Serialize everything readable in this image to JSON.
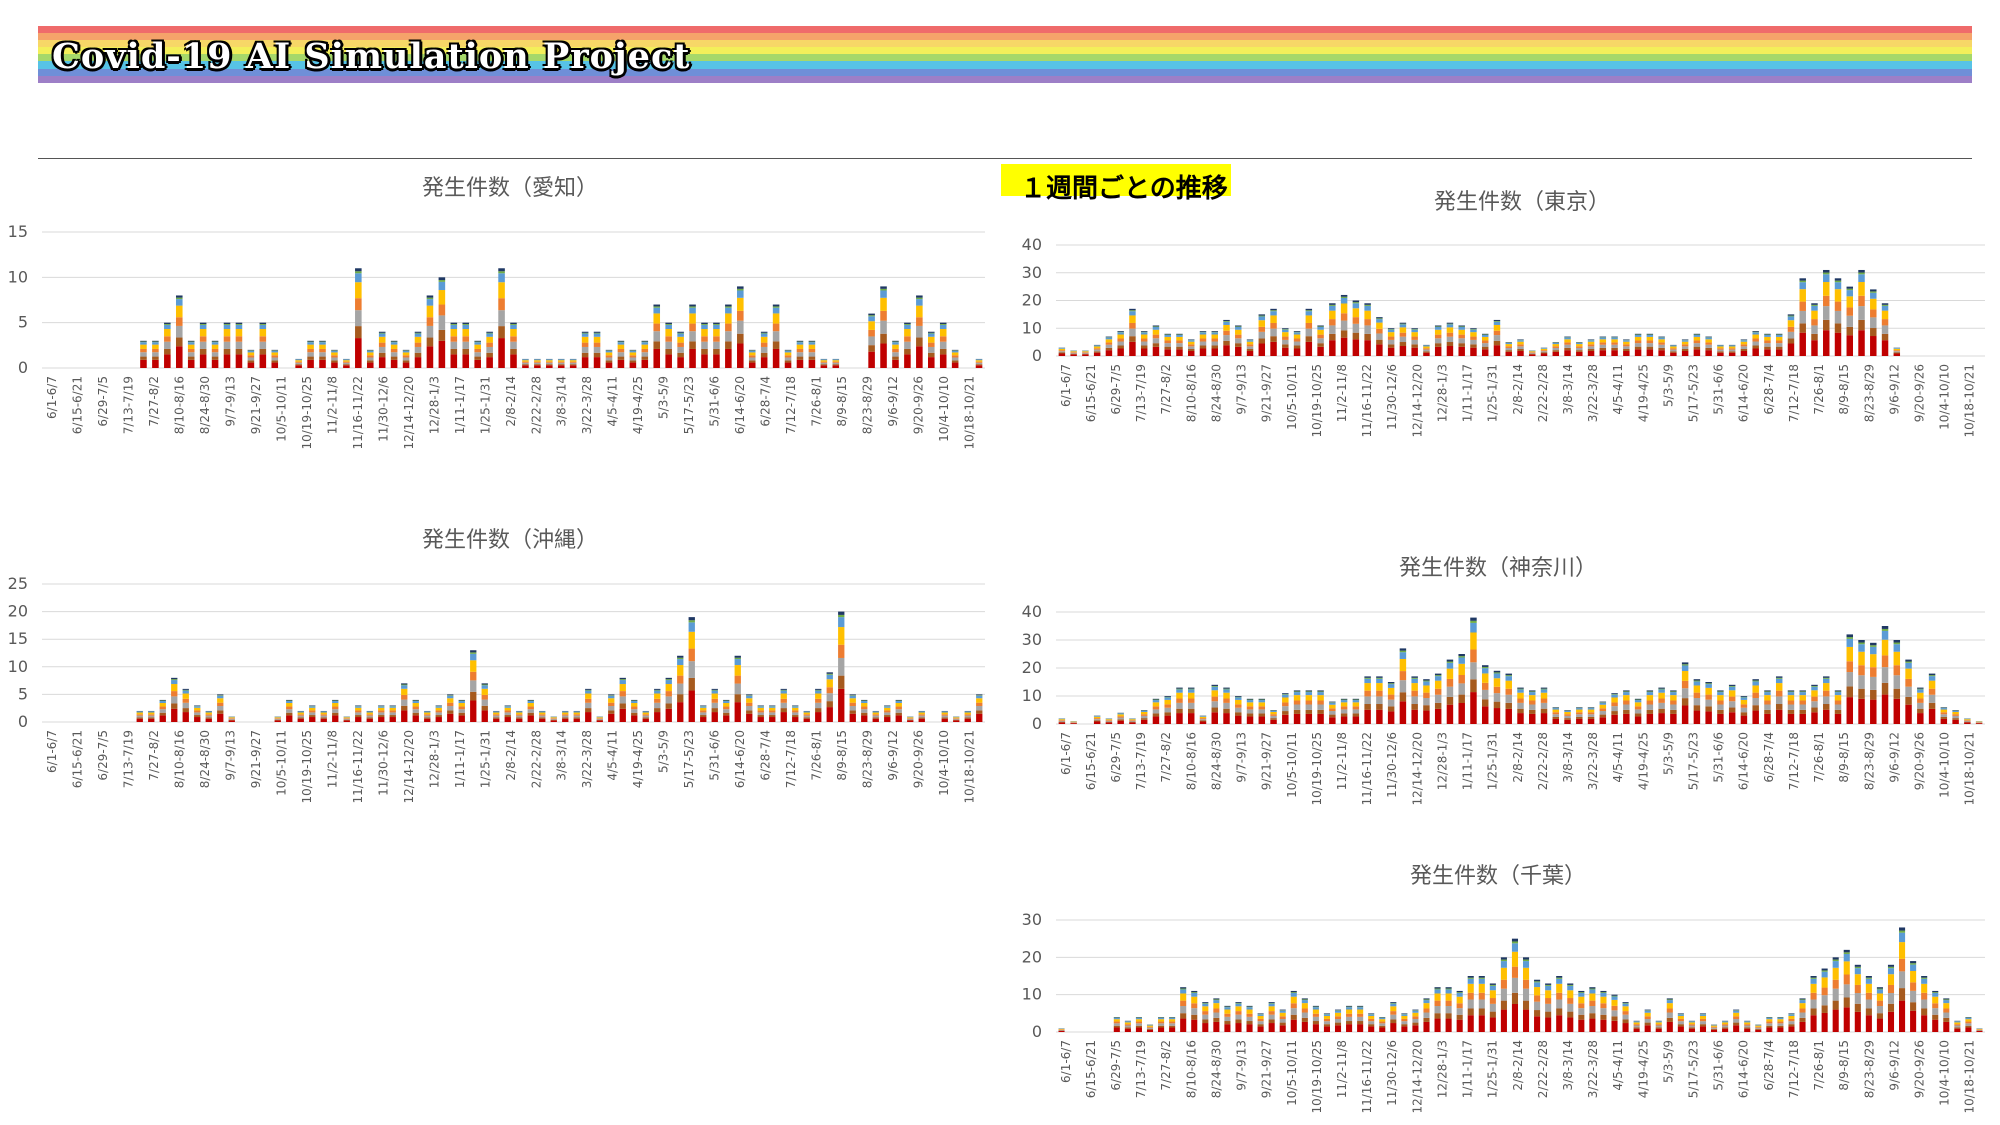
{
  "header": {
    "title": "Covid-19 AI Simulation Project",
    "stripe_colors": [
      "#ef6b6b",
      "#f5a36a",
      "#f7d767",
      "#f3ef5a",
      "#a6d86a",
      "#57c3e6",
      "#6f8fd8",
      "#9d7fc7"
    ]
  },
  "weekly_label": "１週間ごとの推移",
  "colors": {
    "series": [
      "#c00000",
      "#a65a1e",
      "#a5a5a5",
      "#ed7d31",
      "#ffc000",
      "#5b9bd5",
      "#70ad47",
      "#1f3864"
    ],
    "axis_text": "#595959",
    "grid": "#d9d9d9",
    "highlight": "#ffff00"
  },
  "chart_data": [
    {
      "id": "aichi",
      "type": "bar",
      "stacked": true,
      "title": "発生件数（愛知）",
      "ylim": [
        0,
        15
      ],
      "yticks": [
        0,
        5,
        10,
        15
      ],
      "grid": true,
      "x_tick_labels": [
        "6/1-6/7",
        "6/15-6/21",
        "6/29-7/5",
        "7/13-7/19",
        "7/27-8/2",
        "8/10-8/16",
        "8/24-8/30",
        "9/7-9/13",
        "9/21-9/27",
        "10/5-10/11",
        "10/19-10/25",
        "11/2-11/8",
        "11/16-11/22",
        "11/30-12/6",
        "12/14-12/20",
        "12/28-1/3",
        "1/11-1/17",
        "1/25-1/31",
        "2/8-2/14",
        "2/22-2/28",
        "3/8-3/14",
        "3/22-3/28",
        "4/5-4/11",
        "4/19-4/25",
        "5/3-5/9",
        "5/17-5/23",
        "5/31-6/6",
        "6/14-6/20",
        "6/28-7/4",
        "7/12-7/18",
        "7/26-8/1",
        "8/9-8/15",
        "8/23-8/29",
        "9/6-9/12",
        "9/20-9/26",
        "10/4-10/10",
        "10/18-10/21"
      ],
      "totals": [
        0,
        0,
        0,
        0,
        0,
        0,
        0,
        0,
        3,
        3,
        5,
        8,
        3,
        5,
        3,
        5,
        5,
        2,
        5,
        2,
        0,
        1,
        3,
        3,
        2,
        1,
        11,
        2,
        4,
        3,
        2,
        4,
        8,
        10,
        5,
        5,
        3,
        4,
        11,
        5,
        1,
        1,
        1,
        1,
        1,
        4,
        4,
        2,
        3,
        2,
        3,
        7,
        5,
        4,
        7,
        5,
        5,
        7,
        9,
        2,
        4,
        7,
        2,
        3,
        3,
        1,
        1,
        0,
        0,
        6,
        9,
        3,
        5,
        8,
        4,
        5,
        2,
        0,
        1
      ]
    },
    {
      "id": "tokyo",
      "type": "bar",
      "stacked": true,
      "title": "発生件数（東京）",
      "ylim": [
        0,
        40
      ],
      "yticks": [
        0,
        10,
        20,
        30,
        40
      ],
      "grid": true,
      "x_tick_labels": [
        "6/1-6/7",
        "6/15-6/21",
        "6/29-7/5",
        "7/13-7/19",
        "7/27-8/2",
        "8/10-8/16",
        "8/24-8/30",
        "9/7-9/13",
        "9/21-9/27",
        "10/5-10/11",
        "10/19-10/25",
        "11/2-11/8",
        "11/16-11/22",
        "11/30-12/6",
        "12/14-12/20",
        "12/28-1/3",
        "1/11-1/17",
        "1/25-1/31",
        "2/8-2/14",
        "2/22-2/28",
        "3/8-3/14",
        "3/22-3/28",
        "4/5-4/11",
        "4/19-4/25",
        "5/3-5/9",
        "5/17-5/23",
        "5/31-6/6",
        "6/14-6/20",
        "6/28-7/4",
        "7/12-7/18",
        "7/26-8/1",
        "8/9-8/15",
        "8/23-8/29",
        "9/6-9/12",
        "9/20-9/26",
        "10/4-10/10",
        "10/18-10/21"
      ],
      "totals": [
        3,
        2,
        2,
        4,
        7,
        9,
        17,
        9,
        11,
        8,
        8,
        6,
        9,
        9,
        13,
        11,
        6,
        15,
        17,
        10,
        9,
        17,
        11,
        19,
        22,
        20,
        19,
        14,
        10,
        12,
        10,
        4,
        11,
        12,
        11,
        10,
        8,
        13,
        5,
        6,
        2,
        3,
        5,
        7,
        5,
        6,
        7,
        7,
        6,
        8,
        8,
        7,
        4,
        6,
        8,
        7,
        4,
        4,
        6,
        9,
        8,
        8,
        15,
        28,
        19,
        31,
        28,
        25,
        31,
        24,
        19,
        3,
        0,
        0,
        0,
        0,
        0,
        0,
        0
      ]
    },
    {
      "id": "okinawa",
      "type": "bar",
      "stacked": true,
      "title": "発生件数（沖縄）",
      "ylim": [
        0,
        25
      ],
      "yticks": [
        0,
        5,
        10,
        15,
        20,
        25
      ],
      "grid": true,
      "x_tick_labels": [
        "6/1-6/7",
        "6/15-6/21",
        "6/29-7/5",
        "7/13-7/19",
        "7/27-8/2",
        "8/10-8/16",
        "8/24-8/30",
        "9/7-9/13",
        "9/21-9/27",
        "10/5-10/11",
        "10/19-10/25",
        "11/2-11/8",
        "11/16-11/22",
        "11/30-12/6",
        "12/14-12/20",
        "12/28-1/3",
        "1/11-1/17",
        "1/25-1/31",
        "2/8-2/14",
        "2/22-2/28",
        "3/8-3/14",
        "3/22-3/28",
        "4/5-4/11",
        "4/19-4/25",
        "5/3-5/9",
        "5/17-5/23",
        "5/31-6/6",
        "6/14-6/20",
        "6/28-7/4",
        "7/12-7/18",
        "7/26-8/1",
        "8/9-8/15",
        "8/23-8/29",
        "9/6-9/12",
        "9/20-9/26",
        "10/4-10/10",
        "10/18-10/21"
      ],
      "totals": [
        0,
        0,
        0,
        0,
        0,
        0,
        0,
        0,
        2,
        2,
        4,
        8,
        6,
        3,
        2,
        5,
        1,
        0,
        0,
        0,
        1,
        4,
        2,
        3,
        2,
        4,
        1,
        3,
        2,
        3,
        3,
        7,
        4,
        2,
        3,
        5,
        4,
        13,
        7,
        2,
        3,
        2,
        4,
        2,
        1,
        2,
        2,
        6,
        1,
        5,
        8,
        4,
        2,
        6,
        8,
        12,
        19,
        3,
        6,
        4,
        12,
        5,
        3,
        3,
        6,
        3,
        2,
        6,
        9,
        20,
        5,
        4,
        2,
        3,
        4,
        1,
        2,
        0,
        2,
        1,
        2,
        5
      ]
    },
    {
      "id": "kanagawa",
      "type": "bar",
      "stacked": true,
      "title": "発生件数（神奈川）",
      "ylim": [
        0,
        40
      ],
      "yticks": [
        0,
        10,
        20,
        30,
        40
      ],
      "grid": true,
      "x_tick_labels": [
        "6/1-6/7",
        "6/15-6/21",
        "6/29-7/5",
        "7/13-7/19",
        "7/27-8/2",
        "8/10-8/16",
        "8/24-8/30",
        "9/7-9/13",
        "9/21-9/27",
        "10/5-10/11",
        "10/19-10/25",
        "11/2-11/8",
        "11/16-11/22",
        "11/30-12/6",
        "12/14-12/20",
        "12/28-1/3",
        "1/11-1/17",
        "1/25-1/31",
        "2/8-2/14",
        "2/22-2/28",
        "3/8-3/14",
        "3/22-3/28",
        "4/5-4/11",
        "4/19-4/25",
        "5/3-5/9",
        "5/17-5/23",
        "5/31-6/6",
        "6/14-6/20",
        "6/28-7/4",
        "7/12-7/18",
        "7/26-8/1",
        "8/9-8/15",
        "8/23-8/29",
        "9/6-9/12",
        "9/20-9/26",
        "10/4-10/10",
        "10/18-10/21"
      ],
      "totals": [
        2,
        1,
        0,
        3,
        2,
        4,
        2,
        5,
        9,
        10,
        13,
        13,
        3,
        14,
        13,
        10,
        9,
        9,
        5,
        11,
        12,
        12,
        12,
        8,
        9,
        9,
        17,
        17,
        15,
        27,
        17,
        16,
        18,
        23,
        25,
        38,
        21,
        19,
        18,
        13,
        12,
        13,
        6,
        5,
        6,
        6,
        8,
        11,
        12,
        9,
        12,
        13,
        12,
        22,
        16,
        15,
        12,
        14,
        10,
        16,
        12,
        17,
        12,
        12,
        14,
        17,
        12,
        32,
        30,
        29,
        35,
        30,
        23,
        13,
        18,
        6,
        5,
        2,
        1
      ]
    },
    {
      "id": "chiba",
      "type": "bar",
      "stacked": true,
      "title": "発生件数（千葉）",
      "ylim": [
        0,
        30
      ],
      "yticks": [
        0,
        10,
        20,
        30
      ],
      "grid": true,
      "x_tick_labels": [
        "6/1-6/7",
        "6/15-6/21",
        "6/29-7/5",
        "7/13-7/19",
        "7/27-8/2",
        "8/10-8/16",
        "8/24-8/30",
        "9/7-9/13",
        "9/21-9/27",
        "10/5-10/11",
        "10/19-10/25",
        "11/2-11/8",
        "11/16-11/22",
        "11/30-12/6",
        "12/14-12/20",
        "12/28-1/3",
        "1/11-1/17",
        "1/25-1/31",
        "2/8-2/14",
        "2/22-2/28",
        "3/8-3/14",
        "3/22-3/28",
        "4/5-4/11",
        "4/19-4/25",
        "5/3-5/9",
        "5/17-5/23",
        "5/31-6/6",
        "6/14-6/20",
        "6/28-7/4",
        "7/12-7/18",
        "7/26-8/1",
        "8/9-8/15",
        "8/23-8/29",
        "9/6-9/12",
        "9/20-9/26",
        "10/4-10/10",
        "10/18-10/21"
      ],
      "totals": [
        1,
        0,
        0,
        0,
        0,
        4,
        3,
        4,
        2,
        4,
        4,
        12,
        11,
        8,
        9,
        7,
        8,
        7,
        5,
        8,
        6,
        11,
        9,
        7,
        5,
        6,
        7,
        7,
        5,
        4,
        8,
        5,
        6,
        9,
        12,
        12,
        11,
        15,
        15,
        13,
        20,
        25,
        20,
        14,
        13,
        15,
        13,
        11,
        12,
        11,
        10,
        8,
        3,
        6,
        3,
        9,
        5,
        3,
        5,
        2,
        3,
        6,
        3,
        2,
        4,
        4,
        5,
        9,
        15,
        17,
        20,
        22,
        18,
        15,
        12,
        18,
        28,
        19,
        15,
        11,
        9,
        3,
        4,
        1
      ]
    }
  ]
}
